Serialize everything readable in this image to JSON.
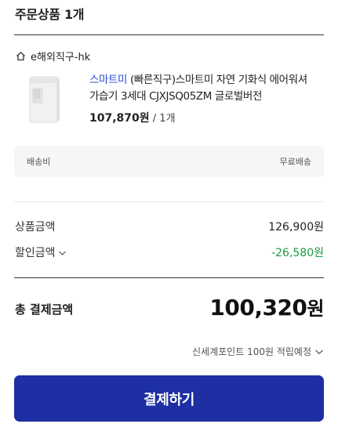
{
  "header": {
    "title": "주문상품 1개"
  },
  "seller": {
    "name": "e해외직구-hk",
    "icon": "home-icon"
  },
  "product": {
    "brand": "스마트미",
    "name": " (빠른직구)스마트미 자연 기화식 에어워셔 가습기 3세대 CJXJSQ05ZM 글로벌버전",
    "price": "107,870원",
    "quantity": " / 1개",
    "thumbnail": "humidifier-image"
  },
  "shipping": {
    "label": "배송비",
    "value": "무료배송"
  },
  "summary": {
    "product_amount_label": "상품금액",
    "product_amount_value": "126,900원",
    "discount_label": "할인금액",
    "discount_value": "-26,580원"
  },
  "total": {
    "label": "총 결제금액",
    "value": "100,320",
    "unit": "원"
  },
  "points": {
    "text": "신세계포인트 100원 적립예정"
  },
  "pay_button": {
    "label": "결제하기"
  },
  "colors": {
    "brand_link": "#2a4bd7",
    "discount": "#1a9b3f",
    "button": "#1e2fa3"
  }
}
